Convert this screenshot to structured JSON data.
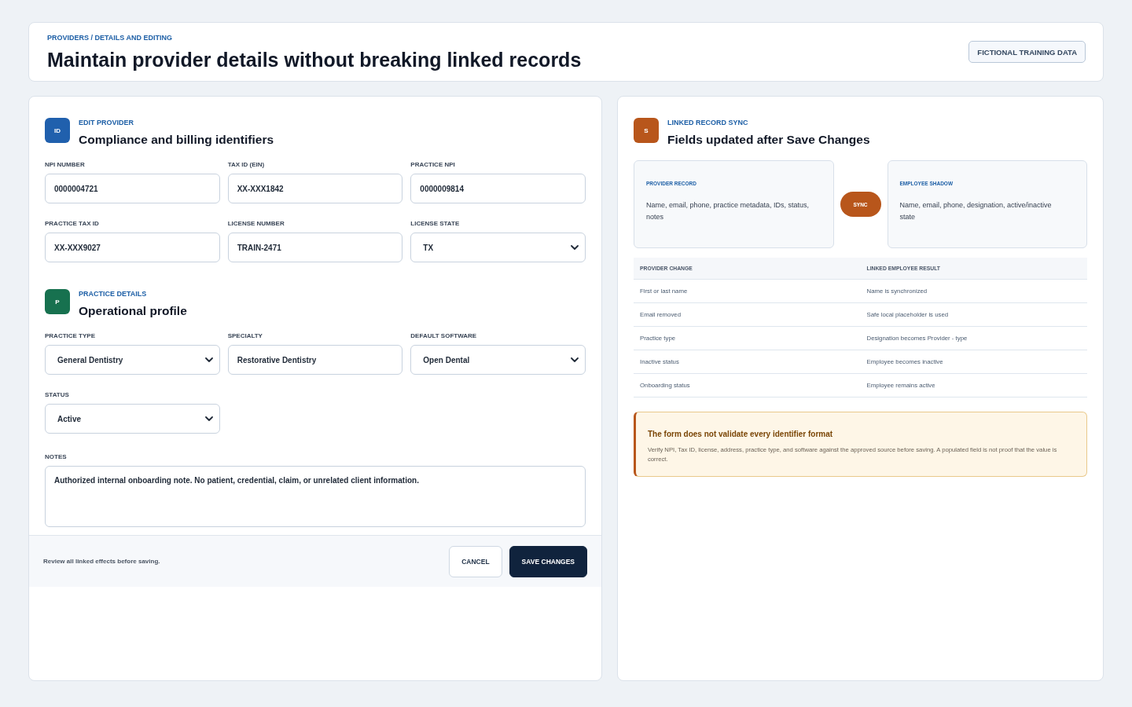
{
  "header": {
    "breadcrumb": "PROVIDERS / DETAILS AND EDITING",
    "title": "Maintain provider details without breaking linked records",
    "tag": "FICTIONAL TRAINING DATA"
  },
  "edit_panel": {
    "sections": [
      {
        "badge": "ID",
        "color": "#2060ad",
        "eyebrow": "EDIT PROVIDER",
        "title": "Compliance and billing identifiers",
        "fields": [
          {
            "label": "NPI NUMBER",
            "kind": "text",
            "value": "0000004721"
          },
          {
            "label": "TAX ID (EIN)",
            "kind": "text",
            "value": "XX-XXX1842"
          },
          {
            "label": "PRACTICE NPI",
            "kind": "text",
            "value": "0000009814"
          },
          {
            "label": "PRACTICE TAX ID",
            "kind": "text",
            "value": "XX-XXX9027"
          },
          {
            "label": "LICENSE NUMBER",
            "kind": "text",
            "value": "TRAIN-2471"
          },
          {
            "label": "LICENSE STATE",
            "kind": "select",
            "value": "TX"
          }
        ]
      },
      {
        "badge": "P",
        "color": "#17714f",
        "eyebrow": "PRACTICE DETAILS",
        "title": "Operational profile",
        "fields": [
          {
            "label": "PRACTICE TYPE",
            "kind": "select",
            "value": "General Dentistry"
          },
          {
            "label": "SPECIALTY",
            "kind": "text",
            "value": "Restorative Dentistry"
          },
          {
            "label": "DEFAULT SOFTWARE",
            "kind": "select",
            "value": "Open Dental"
          },
          {
            "label": "STATUS",
            "kind": "select",
            "value": "Active"
          }
        ]
      }
    ],
    "notes": {
      "label": "NOTES",
      "value": "Authorized internal onboarding note. No patient, credential, claim, or unrelated client information."
    },
    "footer": {
      "hint": "Review all linked effects before saving.",
      "buttons": [
        {
          "label": "CANCEL",
          "kind": "secondary"
        },
        {
          "label": "SAVE CHANGES",
          "kind": "primary"
        }
      ]
    }
  },
  "sync_panel": {
    "badge": "S",
    "eyebrow": "LINKED RECORD SYNC",
    "title": "Fields updated after Save Changes",
    "records": [
      {
        "label": "PROVIDER RECORD",
        "text": "Name, email, phone, practice metadata, IDs, status, notes"
      },
      {
        "label": "EMPLOYEE SHADOW",
        "text": "Name, email, phone, designation, active/inactive state"
      }
    ],
    "sync_label": "SYNC",
    "table": {
      "columns": [
        "PROVIDER CHANGE",
        "LINKED EMPLOYEE RESULT"
      ],
      "rows": [
        [
          "First or last name",
          "Name is synchronized"
        ],
        [
          "Email removed",
          "Safe local placeholder is used"
        ],
        [
          "Practice type",
          "Designation becomes Provider - type"
        ],
        [
          "Inactive status",
          "Employee becomes inactive"
        ],
        [
          "Onboarding status",
          "Employee remains active"
        ]
      ]
    },
    "warning": {
      "title": "The form does not validate every identifier format",
      "text": "Verify NPI, Tax ID, license, address, practice type, and software against the approved source before saving. A populated field is not proof that the value is correct."
    }
  }
}
